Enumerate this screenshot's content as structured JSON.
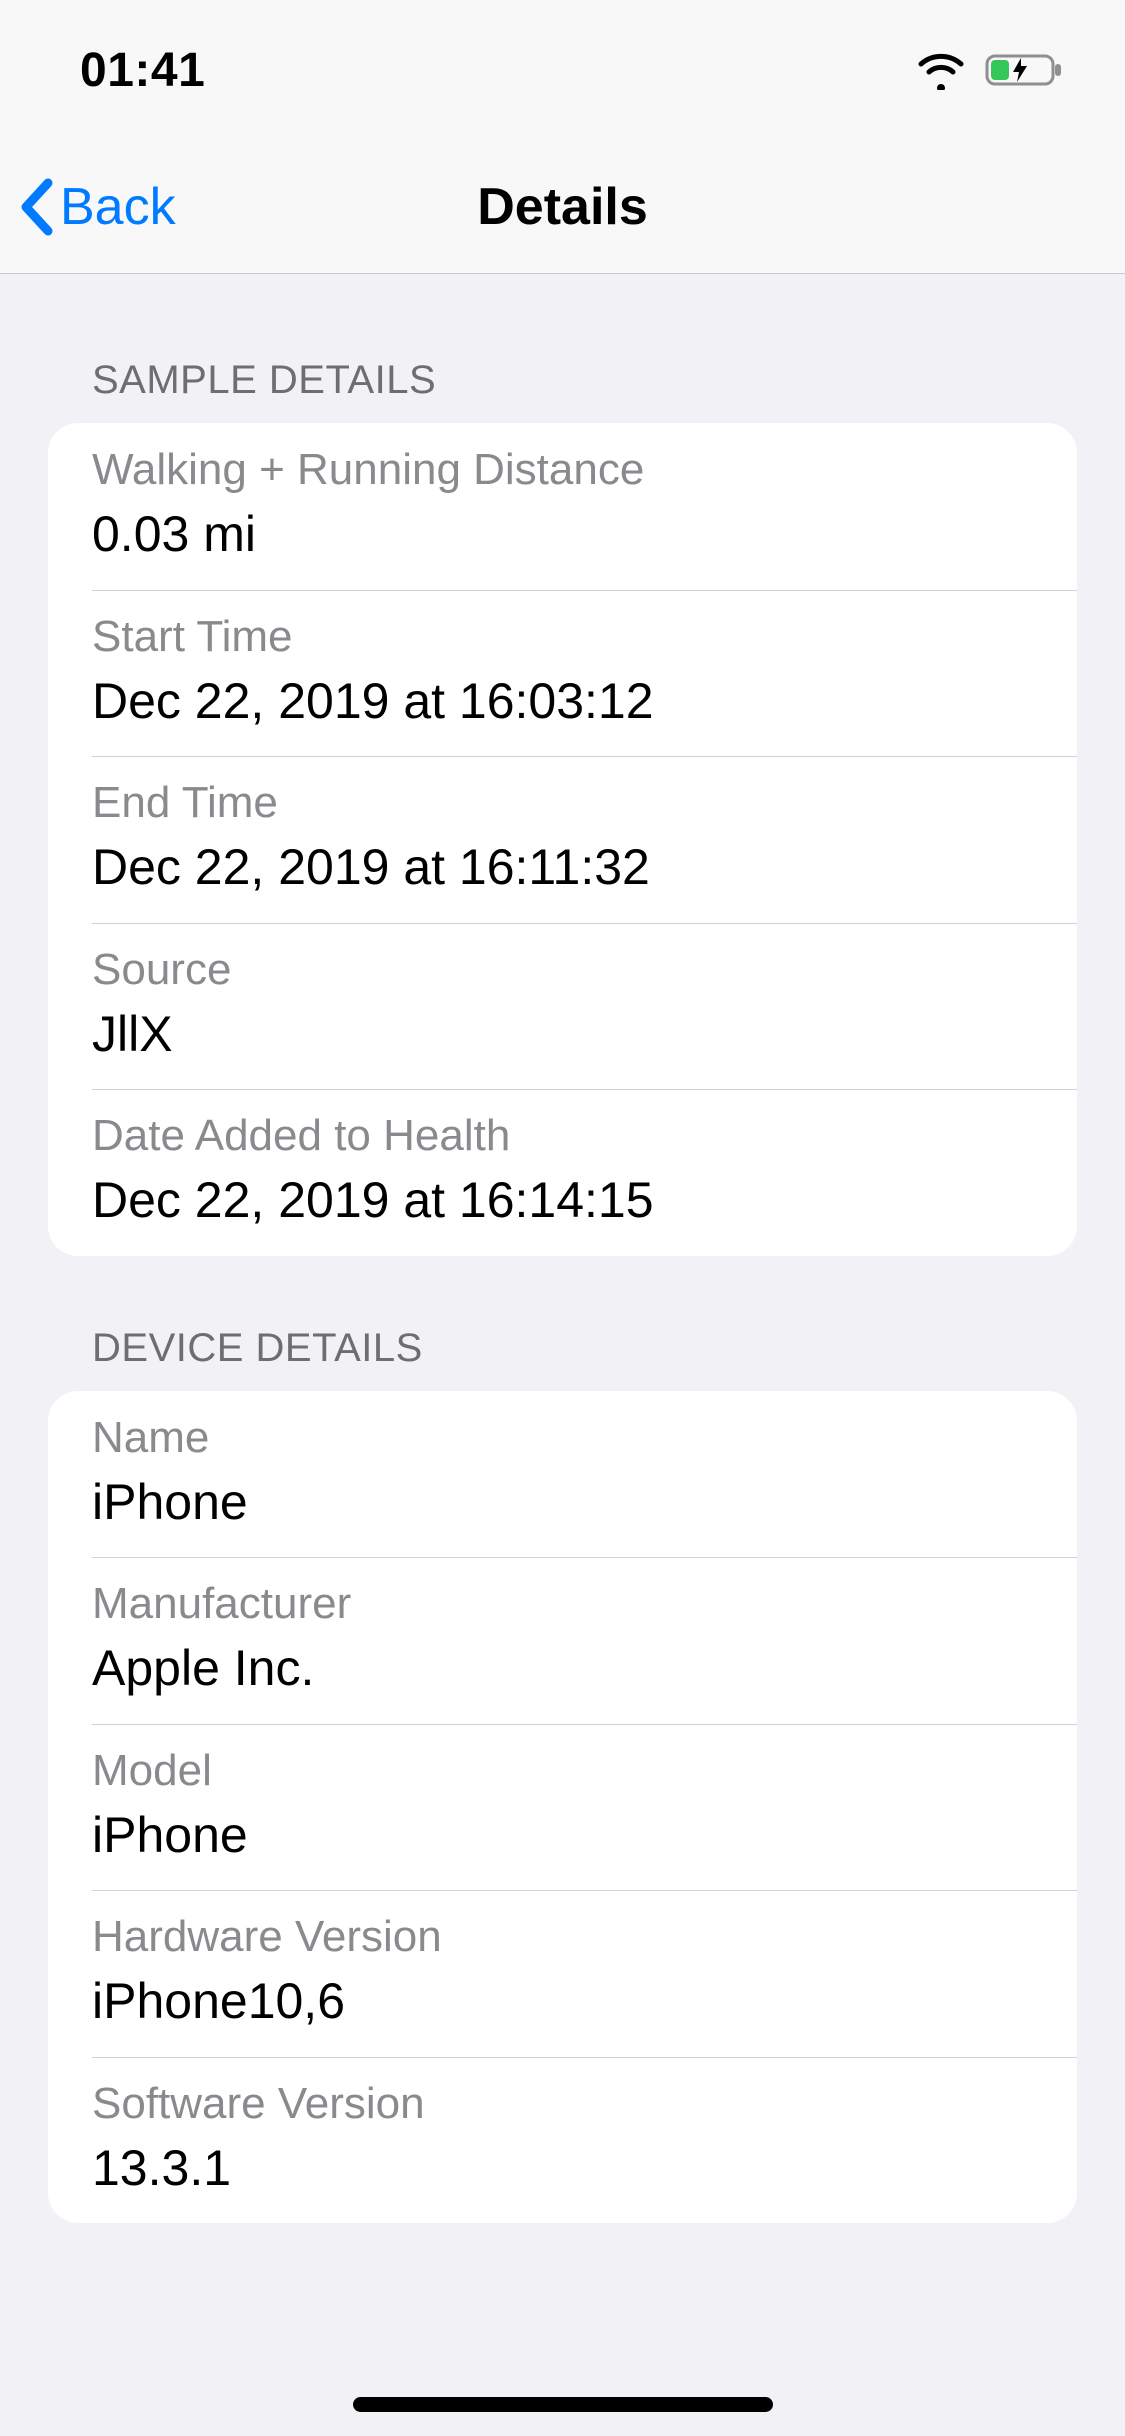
{
  "status": {
    "time": "01:41"
  },
  "nav": {
    "back_label": "Back",
    "title": "Details"
  },
  "sections": {
    "sample": {
      "header": "SAMPLE DETAILS",
      "rows": [
        {
          "label": "Walking + Running Distance",
          "value": "0.03 mi"
        },
        {
          "label": "Start Time",
          "value": "Dec 22, 2019 at 16:03:12"
        },
        {
          "label": "End Time",
          "value": "Dec 22, 2019 at 16:11:32"
        },
        {
          "label": "Source",
          "value": "JllX"
        },
        {
          "label": "Date Added to Health",
          "value": "Dec 22, 2019 at 16:14:15"
        }
      ]
    },
    "device": {
      "header": "DEVICE DETAILS",
      "rows": [
        {
          "label": "Name",
          "value": "iPhone"
        },
        {
          "label": "Manufacturer",
          "value": "Apple Inc."
        },
        {
          "label": "Model",
          "value": "iPhone"
        },
        {
          "label": "Hardware Version",
          "value": "iPhone10,6"
        },
        {
          "label": "Software Version",
          "value": "13.3.1"
        }
      ]
    }
  }
}
